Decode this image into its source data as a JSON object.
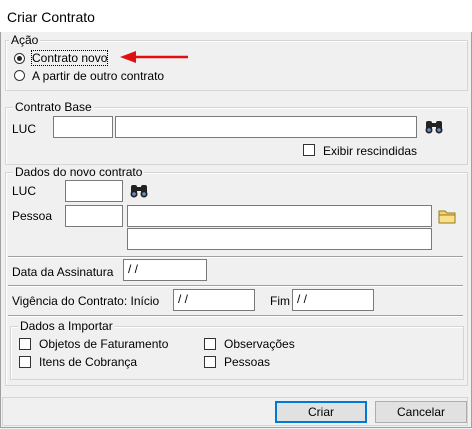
{
  "window": {
    "title": "Criar Contrato"
  },
  "acao": {
    "legend": "Ação",
    "options": [
      {
        "label": "Contrato novo",
        "selected": true
      },
      {
        "label": "A partir de outro contrato",
        "selected": false
      }
    ],
    "arrow_color": "#e01010"
  },
  "contrato_base": {
    "legend": "Contrato Base",
    "luc_label": "LUC",
    "luc_value": "",
    "description_value": "",
    "search_icon": "binoculars-icon",
    "exibir_rescindidas_label": "Exibir rescindidas",
    "exibir_rescindidas_checked": false
  },
  "novo_contrato": {
    "legend": "Dados do novo contrato",
    "luc_label": "LUC",
    "luc_value": "",
    "search_icon": "binoculars-icon",
    "pessoa_label": "Pessoa",
    "pessoa_code": "",
    "pessoa_name": "",
    "pessoa_extra": "",
    "folder_icon": "folder-icon",
    "data_assinatura_label": "Data da Assinatura",
    "data_assinatura_value": " / /",
    "vigencia_label": "Vigência do Contrato: Início",
    "vigencia_inicio_value": " / /",
    "fim_label": "Fim",
    "fim_value": " / /"
  },
  "importar": {
    "legend": "Dados a Importar",
    "items": [
      {
        "label": "Objetos de Faturamento",
        "checked": false
      },
      {
        "label": "Itens de Cobrança",
        "checked": false
      },
      {
        "label": "Observações",
        "checked": false
      },
      {
        "label": "Pessoas",
        "checked": false
      }
    ]
  },
  "buttons": {
    "criar": "Criar",
    "cancelar": "Cancelar"
  }
}
